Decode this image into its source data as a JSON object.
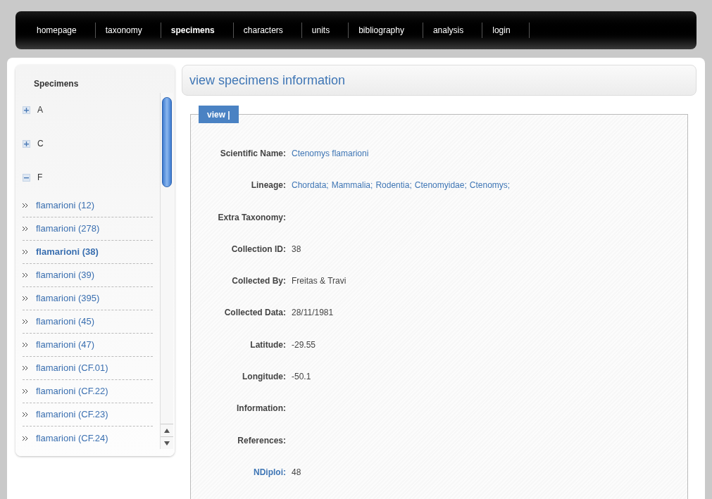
{
  "nav": [
    {
      "label": "homepage",
      "selected": false
    },
    {
      "label": "taxonomy",
      "selected": false
    },
    {
      "label": "specimens",
      "selected": true
    },
    {
      "label": "characters",
      "selected": false
    },
    {
      "label": "units",
      "selected": false
    },
    {
      "label": "bibliography",
      "selected": false
    },
    {
      "label": "analysis",
      "selected": false
    },
    {
      "label": "login",
      "selected": false
    }
  ],
  "sidebar": {
    "title": "Specimens",
    "groups": [
      {
        "label": "A",
        "expanded": false
      },
      {
        "label": "C",
        "expanded": false
      },
      {
        "label": "F",
        "expanded": true,
        "children": [
          {
            "label": "flamarioni (12)",
            "selected": false
          },
          {
            "label": "flamarioni (278)",
            "selected": false
          },
          {
            "label": "flamarioni (38)",
            "selected": true
          },
          {
            "label": "flamarioni (39)",
            "selected": false
          },
          {
            "label": "flamarioni (395)",
            "selected": false
          },
          {
            "label": "flamarioni (45)",
            "selected": false
          },
          {
            "label": "flamarioni (47)",
            "selected": false
          },
          {
            "label": "flamarioni (CF.01)",
            "selected": false
          },
          {
            "label": "flamarioni (CF.22)",
            "selected": false
          },
          {
            "label": "flamarioni (CF.23)",
            "selected": false
          },
          {
            "label": "flamarioni (CF.24)",
            "selected": false
          }
        ]
      }
    ]
  },
  "main": {
    "title": "view specimens information",
    "tab": "view |",
    "fields": [
      {
        "label": "Scientific Name:",
        "label_link": false,
        "value_link": true,
        "values": [
          "Ctenomys flamarioni"
        ]
      },
      {
        "label": "Lineage:",
        "label_link": false,
        "value_link": true,
        "values": [
          "Chordata;",
          "Mammalia;",
          "Rodentia;",
          "Ctenomyidae;",
          "Ctenomys;"
        ]
      },
      {
        "label": "Extra Taxonomy:",
        "label_link": false
      },
      {
        "label": "Collection ID:",
        "label_link": false,
        "value_link": false,
        "values": [
          "38"
        ]
      },
      {
        "label": "Collected By:",
        "label_link": false,
        "value_link": false,
        "values": [
          "Freitas & Travi"
        ]
      },
      {
        "label": "Collected Data:",
        "label_link": false,
        "value_link": false,
        "values": [
          "28/11/1981"
        ]
      },
      {
        "label": "Latitude:",
        "label_link": false,
        "value_link": false,
        "values": [
          "-29.55"
        ]
      },
      {
        "label": "Longitude:",
        "label_link": false,
        "value_link": false,
        "values": [
          "-50.1"
        ]
      },
      {
        "label": "Information:",
        "label_link": false
      },
      {
        "label": "References:",
        "label_link": false
      },
      {
        "label": "NDiploi:",
        "label_link": true,
        "value_link": false,
        "values": [
          "48"
        ]
      }
    ]
  }
}
